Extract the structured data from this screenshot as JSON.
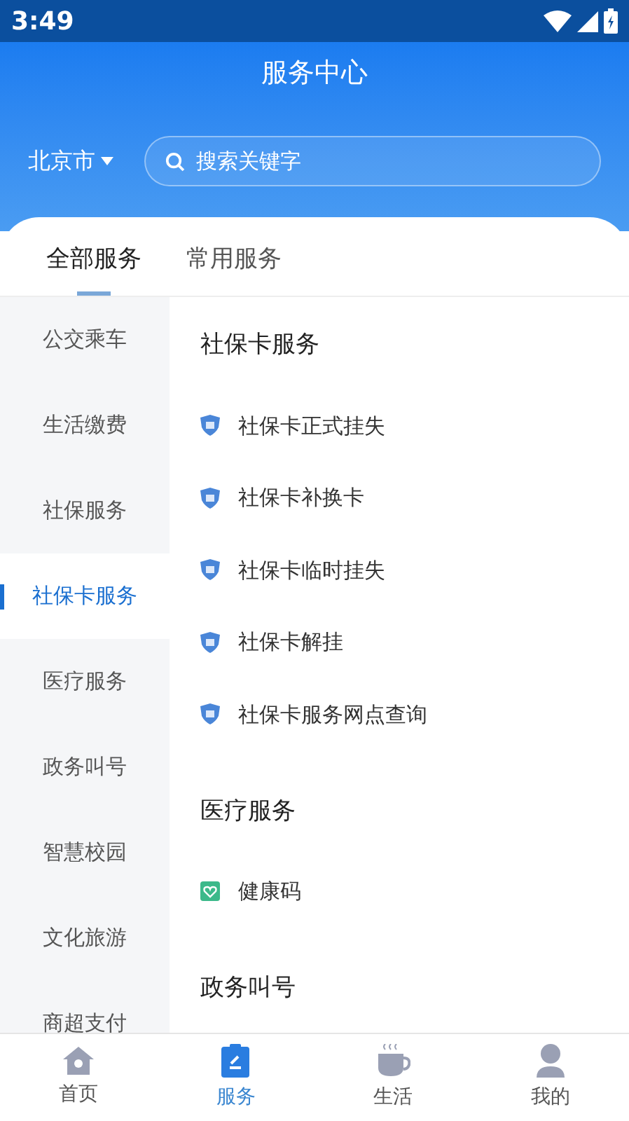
{
  "status_bar": {
    "time": "3:49"
  },
  "header": {
    "title": "服务中心",
    "city": "北京市",
    "search": {
      "placeholder": "搜索关键字"
    }
  },
  "tabs": [
    {
      "label": "全部服务",
      "selected": true
    },
    {
      "label": "常用服务",
      "selected": false
    }
  ],
  "sidebar": {
    "items": [
      {
        "label": "公交乘车",
        "selected": false
      },
      {
        "label": "生活缴费",
        "selected": false
      },
      {
        "label": "社保服务",
        "selected": false
      },
      {
        "label": "社保卡服务",
        "selected": true
      },
      {
        "label": "医疗服务",
        "selected": false
      },
      {
        "label": "政务叫号",
        "selected": false
      },
      {
        "label": "智慧校园",
        "selected": false
      },
      {
        "label": "文化旅游",
        "selected": false
      },
      {
        "label": "商超支付",
        "selected": false
      }
    ]
  },
  "sections": [
    {
      "title": "社保卡服务",
      "items": [
        {
          "label": "社保卡正式挂失",
          "kind": "shield"
        },
        {
          "label": "社保卡补换卡",
          "kind": "shield"
        },
        {
          "label": "社保卡临时挂失",
          "kind": "shield"
        },
        {
          "label": "社保卡解挂",
          "kind": "shield"
        },
        {
          "label": "社保卡服务网点查询",
          "kind": "shield"
        }
      ]
    },
    {
      "title": "医疗服务",
      "items": [
        {
          "label": "健康码",
          "kind": "health"
        }
      ]
    },
    {
      "title": "政务叫号"
    }
  ],
  "bottom_nav": [
    {
      "label": "首页",
      "selected": false
    },
    {
      "label": "服务",
      "selected": true
    },
    {
      "label": "生活",
      "selected": false
    },
    {
      "label": "我的",
      "selected": false
    }
  ]
}
